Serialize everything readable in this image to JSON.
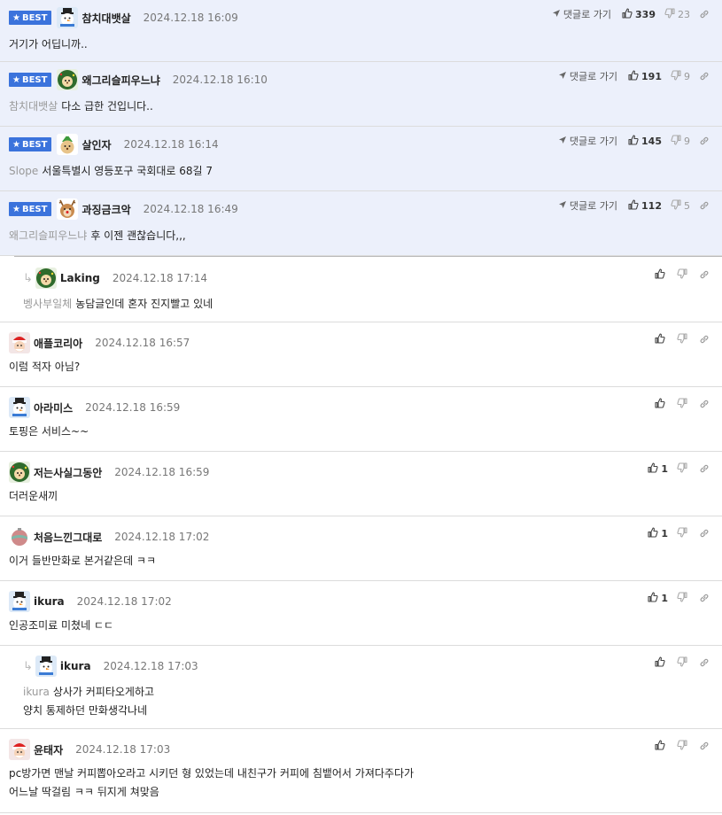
{
  "labels": {
    "best": "BEST",
    "goto": "댓글로 가기"
  },
  "colors": {
    "best_bg": "#ecf0fb",
    "badge": "#3b73dc"
  },
  "comments": [
    {
      "type": "best",
      "nick": "참치대뱃살",
      "date": "2024.12.18 16:09",
      "avatar": "snowman",
      "mention": "",
      "lines": [
        "거기가 어딥니까.."
      ],
      "likes": "339",
      "dislikes": "23"
    },
    {
      "type": "best",
      "nick": "왜그리슬피우느냐",
      "date": "2024.12.18 16:10",
      "avatar": "hedgehog",
      "mention": "참치대뱃살",
      "lines": [
        "다소 급한 건입니다.."
      ],
      "likes": "191",
      "dislikes": "9"
    },
    {
      "type": "best",
      "nick": "살인자",
      "date": "2024.12.18 16:14",
      "avatar": "puppy",
      "mention": "Slope",
      "lines": [
        "서울특별시 영등포구 국회대로 68길 7"
      ],
      "likes": "145",
      "dislikes": "9"
    },
    {
      "type": "best",
      "nick": "과징금크악",
      "date": "2024.12.18 16:49",
      "avatar": "reindeer",
      "mention": "왜그리슬피우느냐",
      "lines": [
        "후 이젠 괜찮습니다,,,"
      ],
      "likes": "112",
      "dislikes": "5"
    },
    {
      "type": "reply",
      "nick": "Laking",
      "date": "2024.12.18 17:14",
      "avatar": "hedgehog",
      "mention": "벵사부일체",
      "lines": [
        "농담글인데 혼자 진지빨고 있네"
      ],
      "likes": "",
      "dislikes": ""
    },
    {
      "type": "normal",
      "nick": "애플코리아",
      "date": "2024.12.18 16:57",
      "avatar": "santa",
      "mention": "",
      "lines": [
        "이럼 적자 아님?"
      ],
      "likes": "",
      "dislikes": ""
    },
    {
      "type": "normal",
      "nick": "아라미스",
      "date": "2024.12.18 16:59",
      "avatar": "snowman",
      "mention": "",
      "lines": [
        "토핑은 서비스~~"
      ],
      "likes": "",
      "dislikes": ""
    },
    {
      "type": "normal",
      "nick": "저는사실그동안",
      "date": "2024.12.18 16:59",
      "avatar": "hedgehog",
      "mention": "",
      "lines": [
        "더러운새끼"
      ],
      "likes": "1",
      "dislikes": ""
    },
    {
      "type": "normal",
      "nick": "처음느낀그대로",
      "date": "2024.12.18 17:02",
      "avatar": "ornament",
      "mention": "",
      "lines": [
        "이거 들반만화로 본거같은데 ㅋㅋ"
      ],
      "likes": "1",
      "dislikes": ""
    },
    {
      "type": "normal",
      "nick": "ikura",
      "date": "2024.12.18 17:02",
      "avatar": "snowman",
      "mention": "",
      "lines": [
        "인공조미료 미쳤네 ㄷㄷ"
      ],
      "likes": "1",
      "dislikes": ""
    },
    {
      "type": "reply",
      "nick": "ikura",
      "date": "2024.12.18 17:03",
      "avatar": "snowman",
      "mention": "ikura",
      "lines": [
        "상사가 커피타오게하고",
        "양치 통제하던 만화생각나네"
      ],
      "likes": "",
      "dislikes": ""
    },
    {
      "type": "normal",
      "nick": "윤태자",
      "date": "2024.12.18 17:03",
      "avatar": "santa",
      "mention": "",
      "lines": [
        "pc방가면 맨날 커피뽑아오라고 시키던 형 있었는데 내친구가 커피에 침뱉어서 가져다주다가",
        "어느날 딱걸림 ㅋㅋ 뒤지게 쳐맞음"
      ],
      "likes": "",
      "dislikes": ""
    }
  ]
}
